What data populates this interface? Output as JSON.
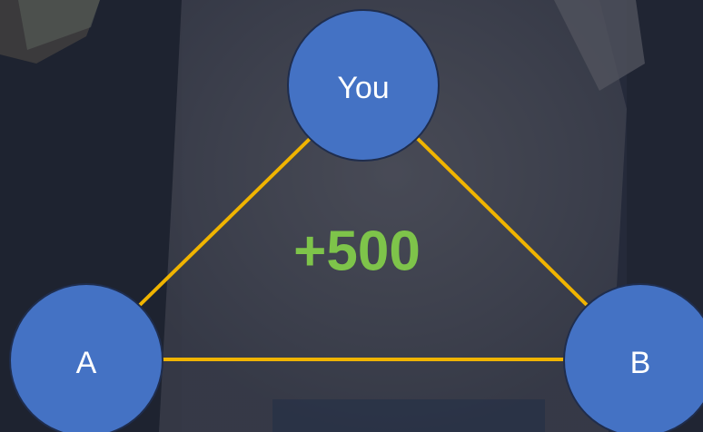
{
  "colors": {
    "background": "#2a3142",
    "node_fill": "#4472c4",
    "node_stroke": "#1f2d4d",
    "edge": "#f0b400",
    "value_text": "#7ec44a",
    "node_text": "#ffffff"
  },
  "nodes": {
    "you": {
      "label": "You"
    },
    "a": {
      "label": "A"
    },
    "b": {
      "label": "B"
    }
  },
  "edges": [
    {
      "from": "you",
      "to": "a"
    },
    {
      "from": "you",
      "to": "b"
    },
    {
      "from": "a",
      "to": "b"
    }
  ],
  "center_value": "+500"
}
